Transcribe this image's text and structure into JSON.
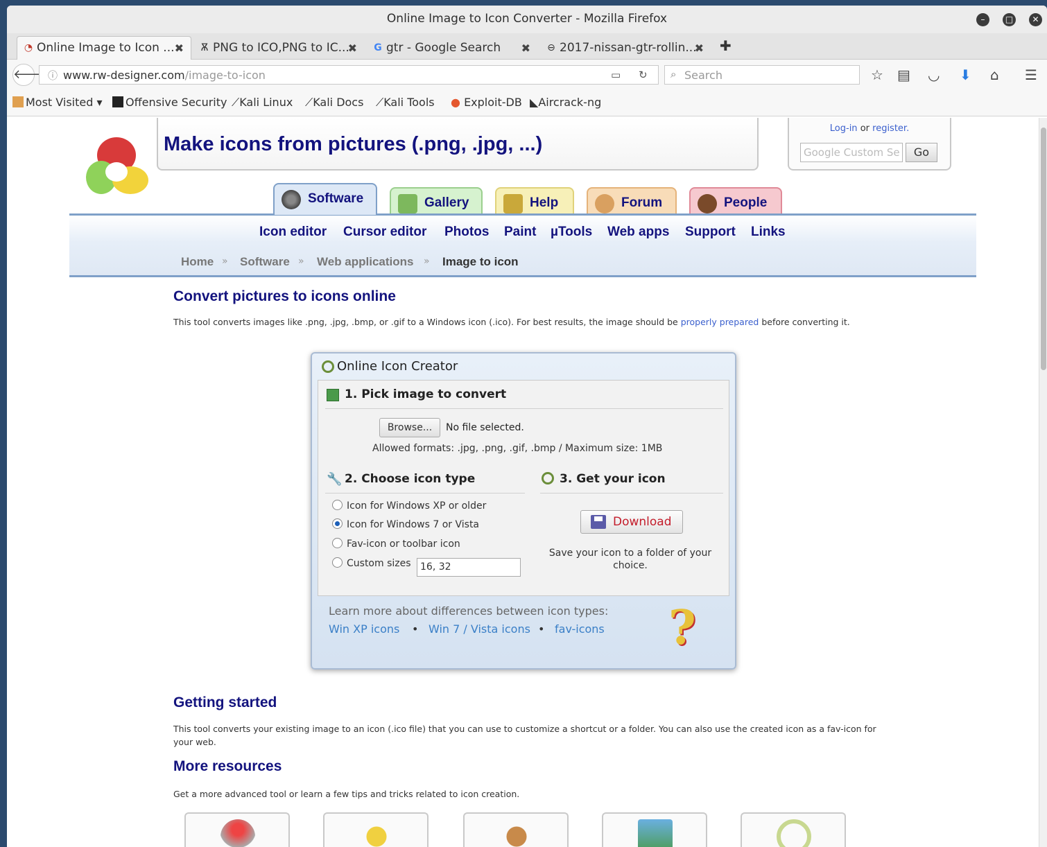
{
  "window": {
    "title": "Online Image to Icon Converter - Mozilla Firefox"
  },
  "tabs": [
    {
      "label": "Online Image to Icon ...",
      "icon": "rw-logo-icon"
    },
    {
      "label": "PNG to ICO,PNG to IC...",
      "icon": "converter-icon"
    },
    {
      "label": "gtr - Google Search",
      "icon": "google-icon"
    },
    {
      "label": "2017-nissan-gtr-rollin...",
      "icon": "image-icon"
    }
  ],
  "nav": {
    "url_host": "www.rw-designer.com",
    "url_path": "/image-to-icon",
    "search_placeholder": "Search"
  },
  "bookmarks": [
    {
      "label": "Most Visited ▾",
      "icon": "folder-icon"
    },
    {
      "label": "Offensive Security",
      "icon": "offsec-icon"
    },
    {
      "label": "Kali Linux",
      "icon": "kali-icon"
    },
    {
      "label": "Kali Docs",
      "icon": "kali-icon"
    },
    {
      "label": "Kali Tools",
      "icon": "kali-icon"
    },
    {
      "label": "Exploit-DB",
      "icon": "exploitdb-icon"
    },
    {
      "label": "Aircrack-ng",
      "icon": "aircrack-icon"
    }
  ],
  "header": {
    "title": "Make icons from pictures (.png, .jpg, ...)",
    "login_text": "Log-in",
    "or_text": "or",
    "register_text": "register.",
    "search_placeholder": "Google Custom Se",
    "go_label": "Go"
  },
  "main_tabs": [
    {
      "label": "Software",
      "color": "#dde8f6"
    },
    {
      "label": "Gallery",
      "color": "#d6f2cf"
    },
    {
      "label": "Help",
      "color": "#f7f0b8"
    },
    {
      "label": "Forum",
      "color": "#f8dcb8"
    },
    {
      "label": "People",
      "color": "#f6c9cf"
    }
  ],
  "subnav": [
    "Icon editor",
    "Cursor editor",
    "Photos",
    "Paint",
    "µTools",
    "Web apps",
    "Support",
    "Links"
  ],
  "breadcrumb": [
    "Home",
    "Software",
    "Web applications",
    "Image to icon"
  ],
  "content": {
    "heading": "Convert pictures to icons online",
    "intro_before": "This tool converts images like .png, .jpg, .bmp, or .gif to a Windows icon (.ico). For best results, the image should be ",
    "intro_link": "properly prepared",
    "intro_after": " before converting it."
  },
  "dialog": {
    "title": "Online Icon Creator",
    "step1": "1. Pick image to convert",
    "browse_label": "Browse...",
    "file_status": "No file selected.",
    "formats": "Allowed formats: .jpg, .png, .gif, .bmp   /   Maximum size: 1MB",
    "step2": "2. Choose icon type",
    "options": [
      {
        "label": "Icon for Windows XP or older",
        "checked": false
      },
      {
        "label": "Icon for Windows 7 or Vista",
        "checked": true
      },
      {
        "label": "Fav-icon or toolbar icon",
        "checked": false
      },
      {
        "label": "Custom sizes",
        "checked": false
      }
    ],
    "custom_sizes_value": "16, 32",
    "step3": "3. Get your icon",
    "download_label": "Download",
    "save_note": "Save your icon to a folder of your choice.",
    "learn_more": "Learn more about differences between icon types:",
    "links": [
      "Win XP icons",
      "Win 7 / Vista icons",
      "fav-icons"
    ]
  },
  "getting_started": {
    "heading": "Getting started",
    "text": "This tool converts your existing image to an icon (.ico file) that you can use to customize a shortcut or a folder. You can also use the created icon as a fav-icon for your web."
  },
  "more_resources": {
    "heading": "More resources",
    "text": "Get a more advanced tool or learn a few tips and tricks related to icon creation."
  }
}
